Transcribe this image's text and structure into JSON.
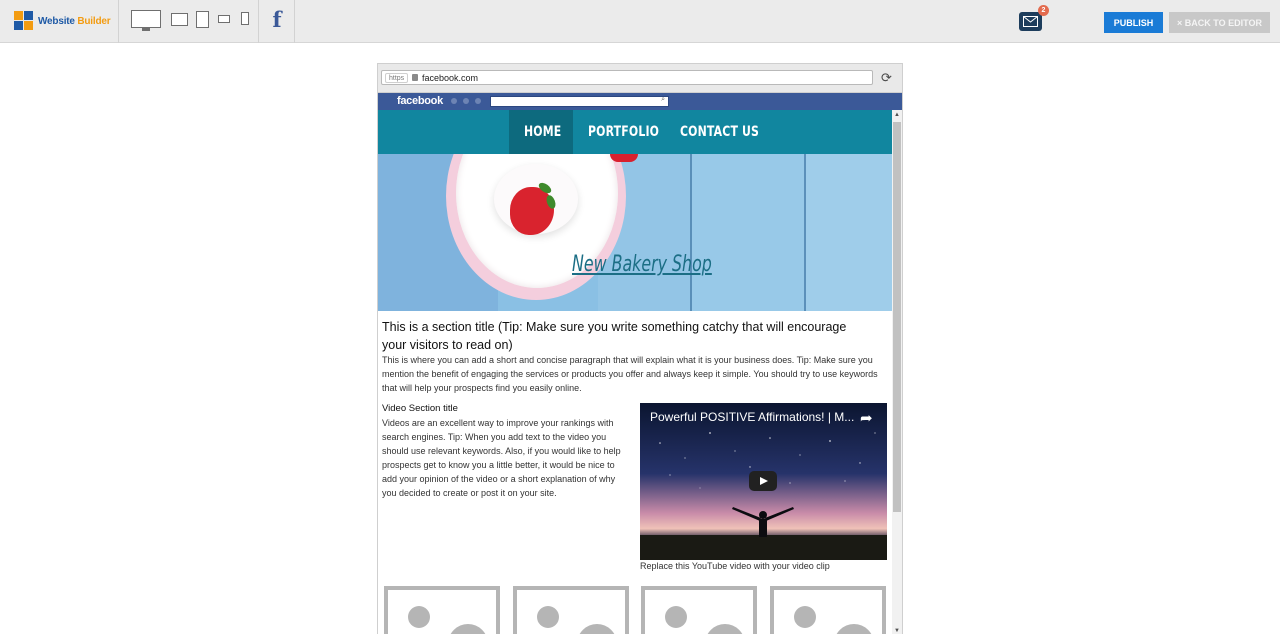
{
  "toolbar": {
    "logo_word1": "Website",
    "logo_word2": "Builder",
    "facebook_glyph": "f",
    "mail_badge": "2",
    "publish_label": "PUBLISH",
    "back_label": "× BACK TO EDITOR",
    "devices": [
      "desktop-icon",
      "tablet-landscape-icon",
      "tablet-portrait-icon",
      "phone-landscape-icon",
      "phone-portrait-icon"
    ]
  },
  "browser": {
    "scheme": "https",
    "url": "facebook.com",
    "reload_glyph": "⟳"
  },
  "facebook_bar": {
    "logo": "facebook",
    "search_glyph": "⌕"
  },
  "site": {
    "nav": [
      {
        "label": "HOME",
        "active": true
      },
      {
        "label": "PORTFOLIO",
        "active": false
      },
      {
        "label": "CONTACT US",
        "active": false
      }
    ],
    "hero_title": "New Bakery Shop",
    "section_title": "This is a section title (Tip: Make sure you write something catchy that will encourage your visitors to read on)",
    "section_body": "This is where you can add a short and concise paragraph that will explain what it is your business does. Tip: Make sure you mention the benefit of engaging the services or products you offer and always keep it simple. You should try to use keywords that will help your prospects find you easily online.",
    "video_section_title": "Video Section title",
    "video_section_body": "Videos are an excellent way to improve your rankings with search engines. Tip: When you add text to the video you should use relevant keywords. Also, if you would like to help prospects get to know you a little better, it would be nice to add your opinion of the video or a short explanation of why you decided to create or post it on your site.",
    "video_title": "Powerful POSITIVE Affirmations! | M...",
    "video_caption": "Replace this YouTube video with your video clip"
  },
  "colors": {
    "nav_bg": "#11869f",
    "nav_active": "#0d6a7e",
    "publish": "#1a7bd6",
    "facebook": "#3b5998"
  }
}
